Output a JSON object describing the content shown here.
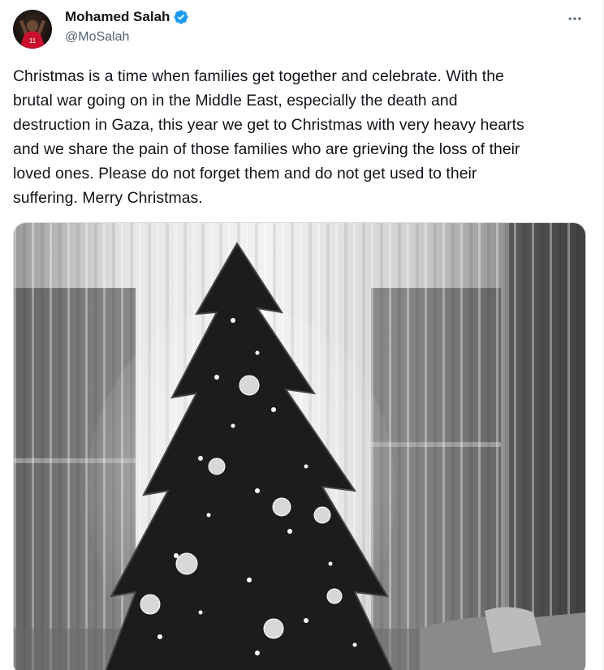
{
  "author": {
    "display_name": "Mohamed Salah",
    "handle": "@MoSalah",
    "verified": true,
    "verified_icon": "verified-badge-icon",
    "avatar_icon": "avatar"
  },
  "actions": {
    "more_icon": "more-horizontal-icon"
  },
  "tweet": {
    "lines": [
      "Christmas is a time when families get together and celebrate. With the",
      "brutal war going on in the Middle East, especially the death and",
      "destruction in Gaza, this year we get to Christmas with very heavy hearts",
      "and we share the pain of those families who are grieving the loss of their",
      "loved ones. Please do not forget them and do not get used to their",
      "suffering. Merry Christmas."
    ]
  },
  "media": {
    "kind": "photo",
    "tone": "black-and-white"
  },
  "colors": {
    "text": "#0f1419",
    "secondary": "#536471",
    "verified": "#1d9bf0",
    "border": "#cfd9de"
  }
}
